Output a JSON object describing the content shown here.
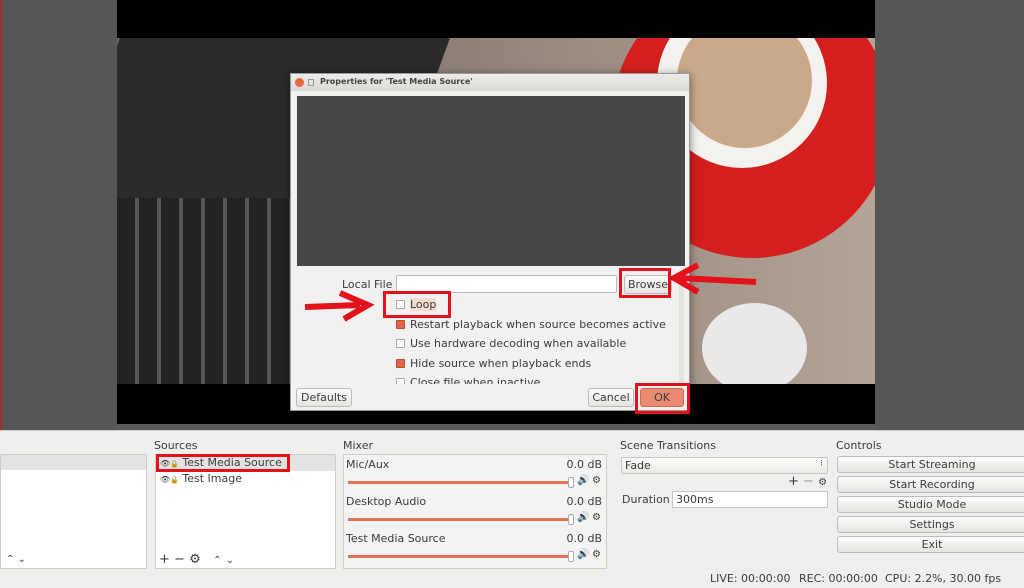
{
  "dialog": {
    "title": "Properties for 'Test Media Source'",
    "local_file_label": "Local File",
    "local_file_value": "",
    "browse": "Browse",
    "options": [
      {
        "label": "Loop",
        "checked": false
      },
      {
        "label": "Restart playback when source becomes active",
        "checked": true
      },
      {
        "label": "Use hardware decoding when available",
        "checked": false
      },
      {
        "label": "Hide source when playback ends",
        "checked": true
      },
      {
        "label": "Close file when inactive",
        "checked": false
      }
    ],
    "defaults": "Defaults",
    "cancel": "Cancel",
    "ok": "OK"
  },
  "sources": {
    "title": "Sources",
    "items": [
      "Test Media Source",
      "Test Image"
    ]
  },
  "mixer": {
    "title": "Mixer",
    "channels": [
      {
        "name": "Mic/Aux",
        "level": "0.0 dB"
      },
      {
        "name": "Desktop Audio",
        "level": "0.0 dB"
      },
      {
        "name": "Test Media Source",
        "level": "0.0 dB"
      }
    ]
  },
  "transitions": {
    "title": "Scene Transitions",
    "selected": "Fade",
    "duration_label": "Duration",
    "duration": "300ms"
  },
  "controls": {
    "title": "Controls",
    "buttons": [
      "Start Streaming",
      "Start Recording",
      "Studio Mode",
      "Settings",
      "Exit"
    ]
  },
  "status": {
    "live": "LIVE: 00:00:00",
    "rec": "REC: 00:00:00",
    "cpu": "CPU: 2.2%, 30.00 fps"
  },
  "colors": {
    "highlight": "#e3111a",
    "accent": "#e0764f"
  }
}
